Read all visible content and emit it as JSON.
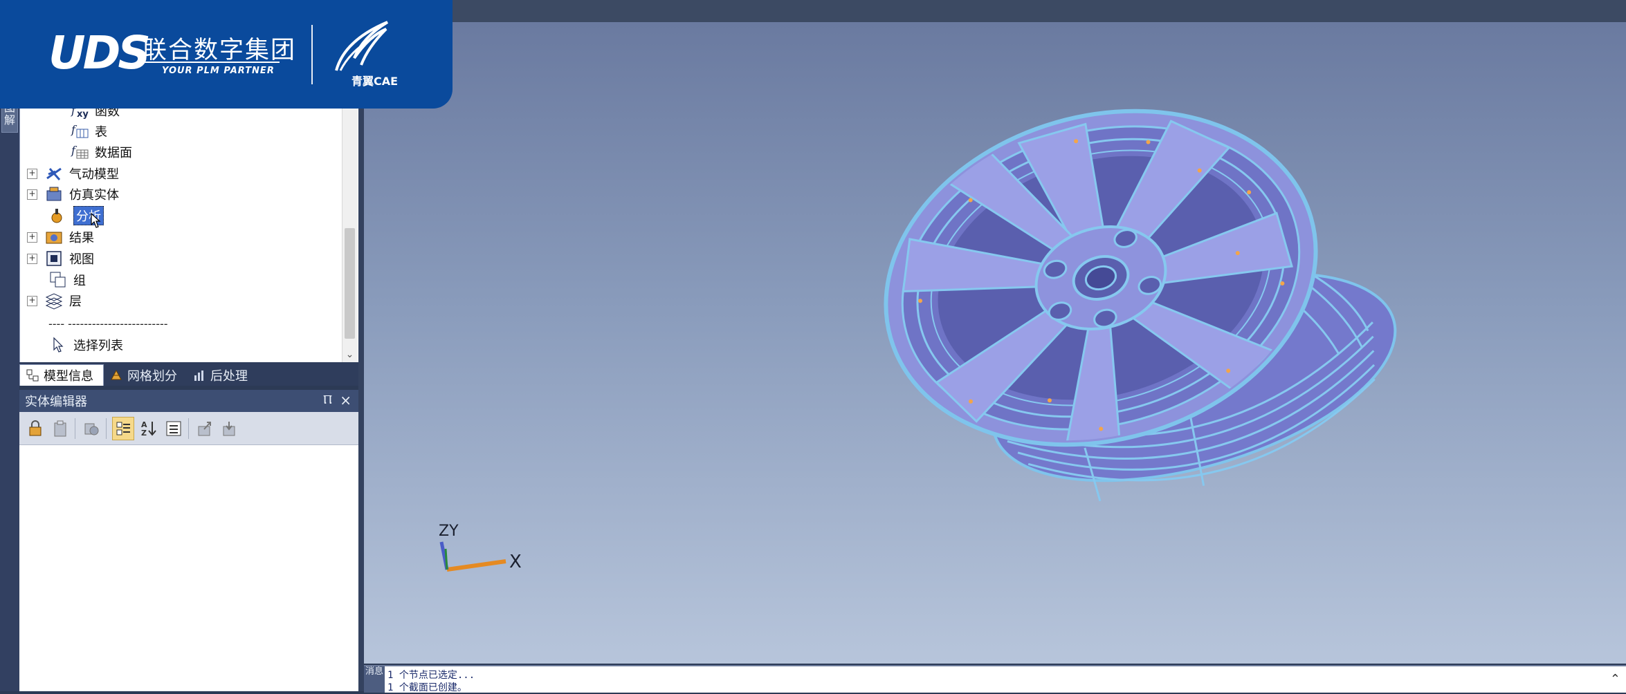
{
  "banner": {
    "logo_text": "UDS",
    "company": "联合数字集团",
    "slogan": "YOUR PLM PARTNER",
    "cae_brand": "青翼CAE"
  },
  "left_strip": {
    "tab_label": "图\n解"
  },
  "tree": {
    "items": [
      {
        "label": "函数",
        "icon": "xy-function-icon"
      },
      {
        "label": "表",
        "icon": "table-function-icon"
      },
      {
        "label": "数据面",
        "icon": "data-surface-icon"
      },
      {
        "label": "气动模型",
        "icon": "aero-model-icon"
      },
      {
        "label": "仿真实体",
        "icon": "simulation-entity-icon"
      },
      {
        "label": "分析",
        "icon": "analysis-icon"
      },
      {
        "label": "结果",
        "icon": "results-icon"
      },
      {
        "label": "视图",
        "icon": "view-icon"
      },
      {
        "label": "组",
        "icon": "group-icon"
      },
      {
        "label": "层",
        "icon": "layer-icon"
      },
      {
        "label": "---- -------------------------"
      },
      {
        "label": "选择列表",
        "icon": "selection-list-icon"
      }
    ],
    "tabs": [
      {
        "label": "模型信息",
        "icon": "model-info-icon"
      },
      {
        "label": "网格划分",
        "icon": "meshing-icon"
      },
      {
        "label": "后处理",
        "icon": "postprocess-icon"
      }
    ]
  },
  "entity_editor": {
    "title": "实体编辑器",
    "pin_glyph": "Ⲡ",
    "close_glyph": "×"
  },
  "viewport": {
    "triad_x": "X",
    "triad_zy": "ZY"
  },
  "log": {
    "tab_label": "消息",
    "lines": [
      "1 个节点已选定...",
      "1 个截面已创建。"
    ]
  },
  "colors": {
    "wheel_fill": "#8d92dc",
    "wheel_mesh": "#7fc4ec",
    "banner_blue": "#0a4a9c",
    "selection_blue": "#3f6fd1"
  }
}
